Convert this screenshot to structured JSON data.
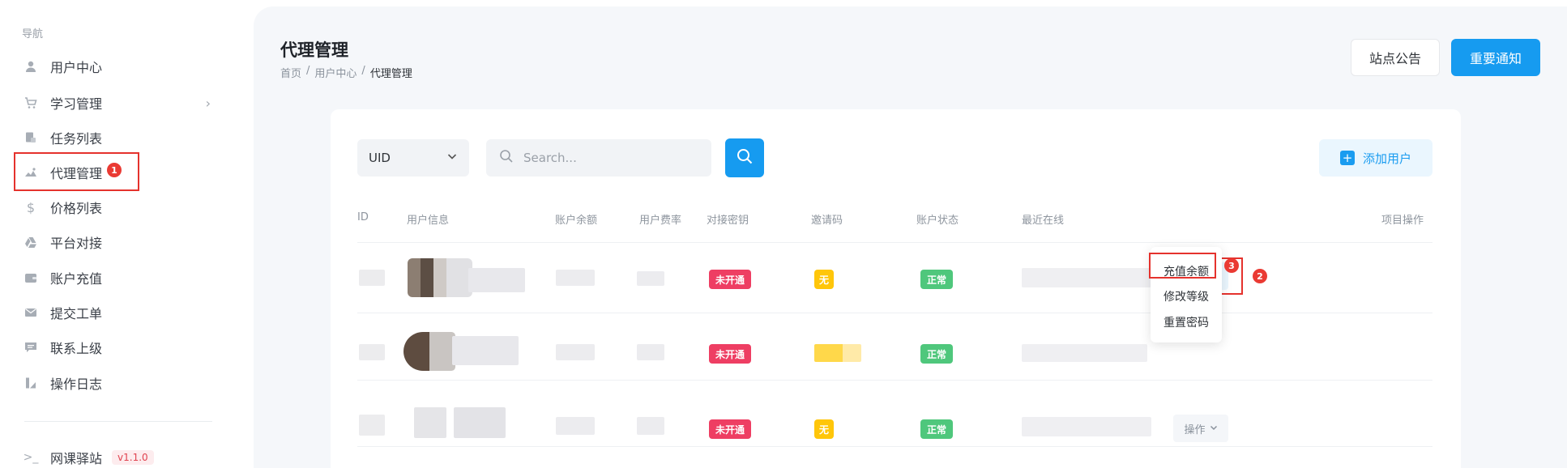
{
  "sidebar": {
    "heading": "导航",
    "items": [
      {
        "label": "用户中心",
        "icon": "user-icon"
      },
      {
        "label": "学习管理",
        "icon": "cart-icon"
      },
      {
        "label": "任务列表",
        "icon": "task-icon"
      },
      {
        "label": "代理管理",
        "icon": "agent-icon"
      },
      {
        "label": "价格列表",
        "icon": "dollar-icon"
      },
      {
        "label": "平台对接",
        "icon": "drive-icon"
      },
      {
        "label": "账户充值",
        "icon": "wallet-icon"
      },
      {
        "label": "提交工单",
        "icon": "mail-icon"
      },
      {
        "label": "联系上级",
        "icon": "chat-icon"
      },
      {
        "label": "操作日志",
        "icon": "log-icon"
      }
    ],
    "footer_label": "网课驿站",
    "version": "v1.1.0"
  },
  "annotations": {
    "one": "1",
    "two": "2",
    "three": "3"
  },
  "header": {
    "title": "代理管理",
    "breadcrumb": [
      "首页",
      "用户中心",
      "代理管理"
    ],
    "breadcrumb_sep": "/",
    "notice_button": "站点公告",
    "important_button": "重要通知"
  },
  "toolbar": {
    "select_value": "UID",
    "search_placeholder": "Search...",
    "add_user": "添加用户"
  },
  "table": {
    "headers": [
      "ID",
      "用户信息",
      "账户余额",
      "用户费率",
      "对接密钥",
      "邀请码",
      "账户状态",
      "最近在线",
      "项目操作"
    ],
    "rows": [
      {
        "key_status": "未开通",
        "invite": "无",
        "status": "正常",
        "action": "操作"
      },
      {
        "key_status": "未开通",
        "invite": "",
        "status": "正常",
        "action": ""
      },
      {
        "key_status": "未开通",
        "invite": "无",
        "status": "正常",
        "action": "操作"
      }
    ]
  },
  "dropdown": {
    "items": [
      "充值余额",
      "修改等级",
      "重置密码"
    ]
  }
}
